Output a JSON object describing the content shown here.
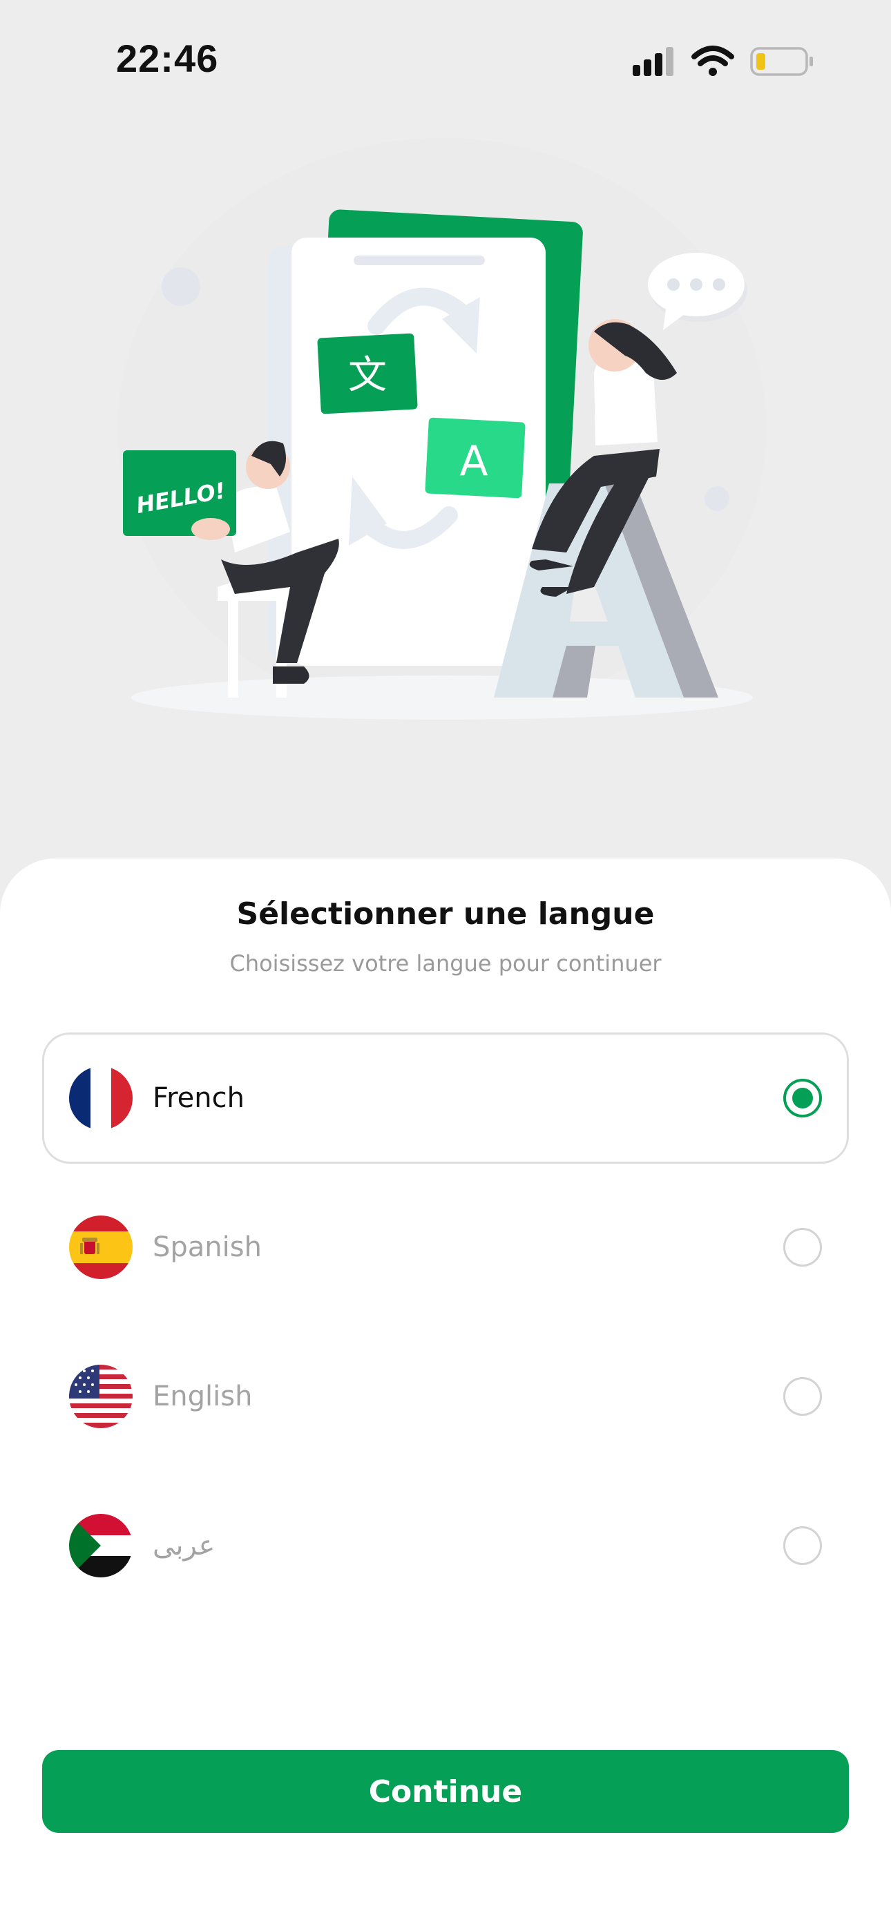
{
  "status_bar": {
    "time": "22:46"
  },
  "illustration": {
    "hello_card_text": "HELLO!",
    "chinese_card_text": "文",
    "latin_card_text": "A",
    "big_letter": "A"
  },
  "sheet": {
    "title": "Sélectionner une langue",
    "subtitle": "Choisissez votre langue pour continuer",
    "languages": [
      {
        "label": "French",
        "flag": "france-flag-icon",
        "selected": true
      },
      {
        "label": "Spanish",
        "flag": "spain-flag-icon",
        "selected": false
      },
      {
        "label": "English",
        "flag": "usa-flag-icon",
        "selected": false
      },
      {
        "label": "عربى",
        "flag": "sudan-flag-icon",
        "selected": false
      }
    ],
    "continue_label": "Continue"
  },
  "colors": {
    "accent": "#069f56",
    "background": "#ededed",
    "sheet": "#ffffff"
  }
}
